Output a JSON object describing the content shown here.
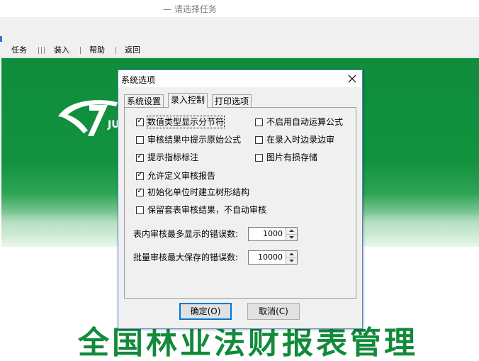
{
  "window": {
    "title": "— 请选择任务"
  },
  "menu": {
    "items": [
      "任务",
      "装入",
      "帮助",
      "返回"
    ]
  },
  "background": {
    "banner_text": "全国林业法财报表管理"
  },
  "dialog": {
    "title": "系统选项",
    "tabs": [
      {
        "label": "系统设置",
        "active": false
      },
      {
        "label": "录入控制",
        "active": true
      },
      {
        "label": "打印选项",
        "active": false
      }
    ],
    "checkboxes": [
      {
        "label": "数值类型显示分节符",
        "checked": true
      },
      {
        "label": "审核结果中提示原始公式",
        "checked": false
      },
      {
        "label": "提示指标标注",
        "checked": true
      },
      {
        "label": "不启用自动运算公式",
        "checked": false
      },
      {
        "label": "在录入时边录边审",
        "checked": false
      },
      {
        "label": "图片有损存储",
        "checked": false
      },
      {
        "label": "允许定义审核报告",
        "checked": true
      },
      {
        "label": "初始化单位时建立树形结构",
        "checked": true
      },
      {
        "label": "保留套表审核结果，不自动审核",
        "checked": false
      }
    ],
    "fields": [
      {
        "label": "表内审核最多显示的错误数:",
        "value": "1000"
      },
      {
        "label": "批量审核最大保存的错误数:",
        "value": "10000"
      }
    ],
    "buttons": {
      "ok": "确定(O)",
      "cancel": "取消(C)"
    }
  },
  "colors": {
    "accent": "#0078d7",
    "brand_green": "#12923f"
  }
}
